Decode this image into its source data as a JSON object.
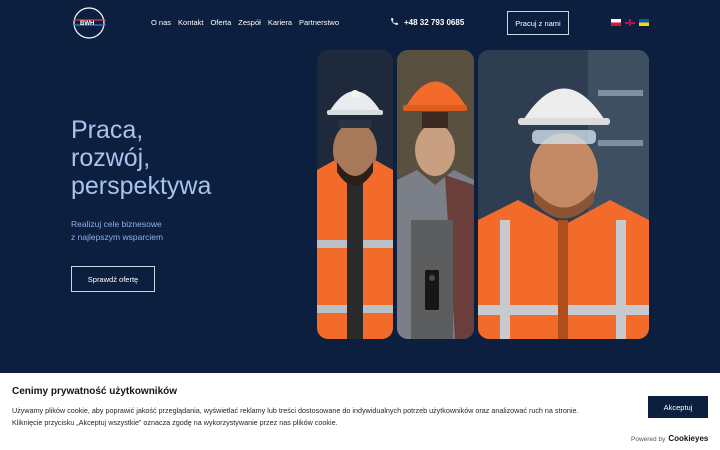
{
  "header": {
    "nav": [
      "O nas",
      "Kontakt",
      "Oferta",
      "Zespół",
      "Kariera",
      "Partnerstwo"
    ],
    "phone": "+48 32 793 0685",
    "cta_label": "Pracuj z nami",
    "languages": [
      "pl",
      "en",
      "ua"
    ]
  },
  "hero": {
    "title_lines": [
      "Praca,",
      "rozwój,",
      "perspektywa"
    ],
    "subtitle_lines": [
      "Realizuj cele biznesowe",
      "z najlepszym wsparciem"
    ],
    "button_label": "Sprawdź ofertę"
  },
  "colors": {
    "background": "#0c1f3f",
    "hero_title": "#a9c3ee",
    "hero_subtitle": "#8fb0e6",
    "safety_orange": "#f26b2a"
  },
  "cookie": {
    "title": "Cenimy prywatność użytkowników",
    "text_lines": [
      "Używamy plików cookie, aby poprawić jakość przeglądania, wyświetlać reklamy lub treści dostosowane do indywidualnych potrzeb użytkowników oraz analizować ruch na stronie.",
      "Kliknięcie przycisku „Akceptuj wszystkie” oznacza zgodę na wykorzystywanie przez nas plików cookie."
    ],
    "accept_label": "Akceptuj",
    "powered_by": "Powered by",
    "powered_brand": "Cookieyes"
  }
}
